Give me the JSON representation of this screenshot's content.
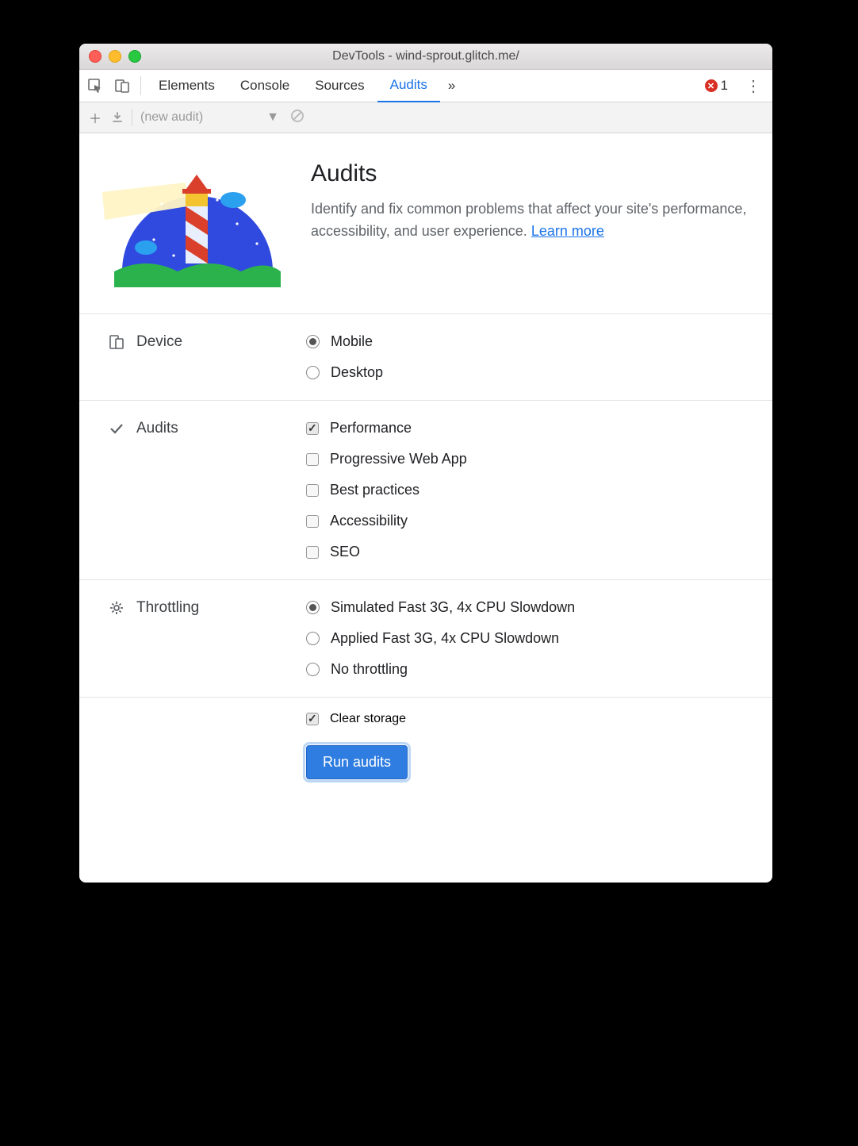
{
  "window": {
    "title": "DevTools - wind-sprout.glitch.me/"
  },
  "tabs": {
    "items": [
      "Elements",
      "Console",
      "Sources",
      "Audits"
    ],
    "active": "Audits",
    "error_count": "1"
  },
  "toolbar": {
    "audit_selector": "(new audit)"
  },
  "hero": {
    "title": "Audits",
    "body_prefix": "Identify and fix common problems that affect your site's performance, accessibility, and user experience. ",
    "learn_more": "Learn more"
  },
  "sections": {
    "device": {
      "label": "Device",
      "options": [
        {
          "label": "Mobile",
          "selected": true
        },
        {
          "label": "Desktop",
          "selected": false
        }
      ]
    },
    "audits": {
      "label": "Audits",
      "options": [
        {
          "label": "Performance",
          "checked": true
        },
        {
          "label": "Progressive Web App",
          "checked": false
        },
        {
          "label": "Best practices",
          "checked": false
        },
        {
          "label": "Accessibility",
          "checked": false
        },
        {
          "label": "SEO",
          "checked": false
        }
      ]
    },
    "throttling": {
      "label": "Throttling",
      "options": [
        {
          "label": "Simulated Fast 3G, 4x CPU Slowdown",
          "selected": true
        },
        {
          "label": "Applied Fast 3G, 4x CPU Slowdown",
          "selected": false
        },
        {
          "label": "No throttling",
          "selected": false
        }
      ]
    },
    "clear_storage": {
      "label": "Clear storage",
      "checked": true
    }
  },
  "run_button": "Run audits"
}
